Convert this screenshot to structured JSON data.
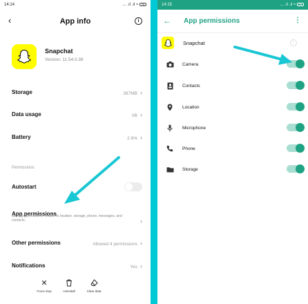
{
  "left": {
    "status": {
      "time": "14:14",
      "icons": "... .ıl .ıl ≈",
      "battery": "79"
    },
    "header": {
      "title": "App info"
    },
    "app": {
      "name": "Snapchat",
      "version": "Version: 11.54.0.38"
    },
    "rows": {
      "storage": {
        "label": "Storage",
        "value": "387MB"
      },
      "data_usage": {
        "label": "Data usage",
        "value": "0B"
      },
      "battery": {
        "label": "Battery",
        "value": "2.6%"
      }
    },
    "section_label": "Permissions",
    "autostart": {
      "label": "Autostart",
      "enabled": false
    },
    "app_permissions": {
      "label": "App permissions",
      "description": "Manage permissions related to location, storage, phone, messages, and contacts."
    },
    "other_permissions": {
      "label": "Other permissions",
      "value": "Allowed 4 permissions"
    },
    "notifications": {
      "label": "Notifications",
      "value": "Yes"
    },
    "bottom_actions": [
      {
        "icon": "close-icon",
        "label": "Force stop"
      },
      {
        "icon": "trash-icon",
        "label": "Uninstall"
      },
      {
        "icon": "eraser-icon",
        "label": "Clear data"
      }
    ]
  },
  "right": {
    "status": {
      "time": "14:15",
      "icons": "... .ıl .ıl ≈",
      "battery": "79"
    },
    "header": {
      "title": "App permissions"
    },
    "app": {
      "name": "Snapchat"
    },
    "permissions": [
      {
        "icon": "camera-icon",
        "label": "Camera",
        "enabled": true
      },
      {
        "icon": "contacts-icon",
        "label": "Contacts",
        "enabled": true
      },
      {
        "icon": "location-icon",
        "label": "Location",
        "enabled": true
      },
      {
        "icon": "microphone-icon",
        "label": "Microphone",
        "enabled": true
      },
      {
        "icon": "phone-icon",
        "label": "Phone",
        "enabled": true
      },
      {
        "icon": "folder-icon",
        "label": "Storage",
        "enabled": true
      }
    ],
    "accent_color": "#1fa283"
  },
  "annotation": {
    "arrow_color": "#19c6d4"
  }
}
